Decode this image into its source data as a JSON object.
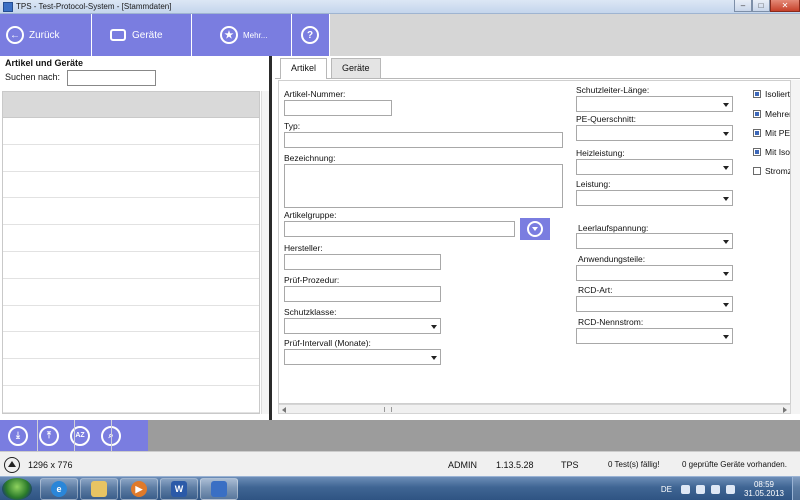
{
  "window": {
    "title": "TPS - Test-Protocol-System - [Stammdaten]",
    "minimize": "–",
    "maximize": "□",
    "close": "✕"
  },
  "toolbar": {
    "back_label": "Zurück",
    "devices_label": "Geräte",
    "more_label": "Mehr...",
    "help_glyph": "?",
    "back_glyph": "←",
    "more_glyph": "★"
  },
  "left": {
    "heading": "Artikel und Geräte",
    "search_label": "Suchen  nach:",
    "search_value": "",
    "row_count": 12
  },
  "tabs": [
    {
      "label": "Artikel",
      "active": true
    },
    {
      "label": "Geräte",
      "active": false
    }
  ],
  "form": {
    "col1": {
      "artikel_nummer": "Artikel-Nummer:",
      "typ": "Typ:",
      "bezeichnung": "Bezeichnung:",
      "artikelgruppe": "Artikelgruppe:",
      "hersteller": "Hersteller:",
      "pruef_prozedur": "Prüf-Prozedur:",
      "schutzklasse": "Schutzklasse:",
      "pruef_intervall": "Prüf-Intervall (Monate):"
    },
    "col2": {
      "schutzleiter_laenge": "Schutzleiter-Länge:",
      "pe_querschnitt": "PE-Querschnitt:",
      "heizleistung": "Heizleistung:",
      "leistung": "Leistung:",
      "leerlaufspannung": "Leerlaufspannung:",
      "anwendungsteile": "Anwendungsteile:",
      "rcd_art": "RCD-Art:",
      "rcd_nennstrom": "RCD-Nennstrom:"
    },
    "checkboxes": [
      {
        "label": "Isolierte",
        "checked": true
      },
      {
        "label": "Mehrere",
        "checked": true
      },
      {
        "label": "Mit PE-",
        "checked": true
      },
      {
        "label": "Mit Iso-",
        "checked": true
      },
      {
        "label": "Stromza",
        "checked": false
      }
    ]
  },
  "bottombar": {
    "buttons": [
      "download-icon",
      "upload-icon",
      "sort-az-icon",
      "search-icon"
    ],
    "glyphs": [
      "⤓",
      "⤒",
      "AZ",
      "⌕"
    ]
  },
  "status": {
    "resolution": "1296 x 776",
    "user": "ADMIN",
    "version": "1.13.5.28",
    "app": "TPS",
    "tests_due": "0 Test(s) fällig!",
    "devices_checked": "0 geprüfte Geräte vorhanden."
  },
  "taskbar": {
    "word_label": "W",
    "language": "DE",
    "time": "08:59",
    "date": "31.05.2013"
  },
  "colors": {
    "accent": "#7a7de0",
    "checkbox": "#3d67b8"
  }
}
